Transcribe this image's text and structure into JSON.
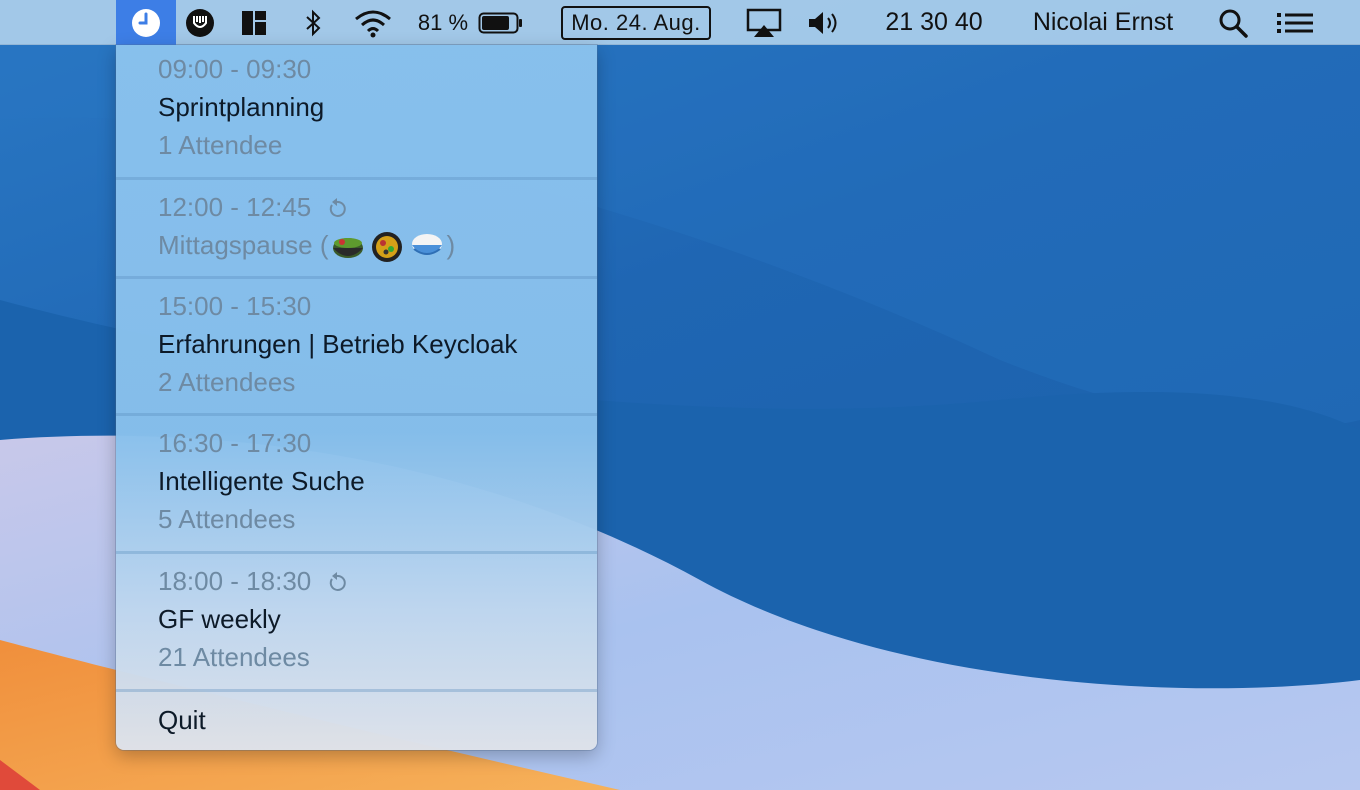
{
  "menubar": {
    "battery_percent": "81 %",
    "date": "Mo. 24. Aug.",
    "clock": "21 30 40",
    "user": "Nicolai Ernst",
    "icons": [
      "clock-icon",
      "yoink-icon",
      "window-layout-icon",
      "bluetooth-icon",
      "wifi-icon",
      "battery-icon",
      "airplay-icon",
      "volume-icon",
      "spotlight-search-icon",
      "control-list-icon"
    ]
  },
  "events": [
    {
      "time": "09:00 - 09:30",
      "title": "Sprintplanning",
      "attendees": "1 Attendee",
      "recurring": false
    },
    {
      "time": "12:00 - 12:45",
      "title": "Mittagspause (",
      "title_end": ")",
      "emojis": [
        "salad-bowl-icon",
        "paella-pan-icon",
        "rice-bowl-icon"
      ],
      "attendees": "",
      "recurring": true
    },
    {
      "time": "15:00 - 15:30",
      "title": "Erfahrungen | Betrieb Keycloak",
      "attendees": "2 Attendees",
      "recurring": false
    },
    {
      "time": "16:30 - 17:30",
      "title": "Intelligente Suche",
      "attendees": "5 Attendees",
      "recurring": false
    },
    {
      "time": "18:00 - 18:30",
      "title": "GF weekly",
      "attendees": "21 Attendees",
      "recurring": true
    }
  ],
  "quit_label": "Quit",
  "colors": {
    "menubar": "#adcfec",
    "active_icon_bg": "#3d7ee6",
    "dropdown": "#8ac2ee",
    "desktop": "#1f66b3"
  }
}
